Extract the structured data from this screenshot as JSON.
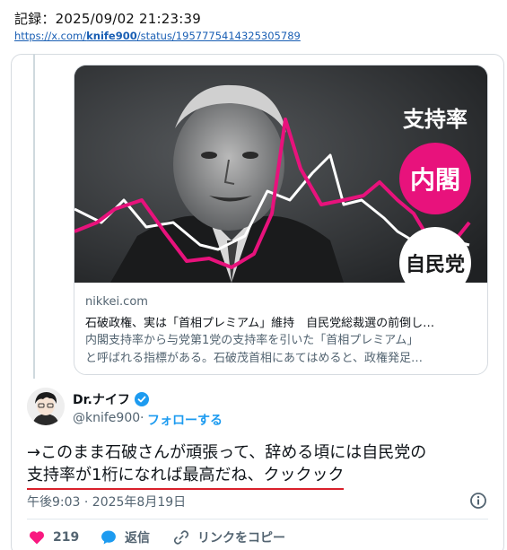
{
  "record": {
    "label": "記録：2025/09/02 21:23:39",
    "url_prefix": "https://x.com/",
    "url_user": "knife900",
    "url_suffix": "/status/1957775414325305789"
  },
  "link_card": {
    "image_text": {
      "heading": "支持率",
      "badge1": "内閣",
      "badge2": "自民党"
    },
    "domain": "nikkei.com",
    "title": "石破政権、実は「首相プレミアム」維持　自民党総裁選の前倒し…",
    "description_line1": "内閣支持率から与党第1党の支持率を引いた「首相プレミアム」",
    "description_line2": "と呼ばれる指標がある。石破茂首相にあてはめると、政権発足…",
    "colors": {
      "pink": "#e8127c",
      "dark": "#2b2d2f"
    }
  },
  "tweet": {
    "author_name": "Dr.ナイフ",
    "handle": "@knife900",
    "follow_label": "フォローする",
    "text_line1": "→このまま石破さんが頑張って、辞める頃には自民党の",
    "text_line2": "支持率が1桁になれば最高だね、クックック",
    "timestamp": "午後9:03 · 2025年8月19日",
    "like_count": "219",
    "reply_label": "返信",
    "copy_label": "リンクをコピー",
    "colors": {
      "accent": "#1d9bf0",
      "like": "#f91880",
      "underline": "#d9202b"
    }
  },
  "icons": {
    "verified": "verified-badge-icon",
    "info": "info-icon",
    "like": "heart-icon",
    "reply": "speech-bubble-icon",
    "copy": "link-icon"
  }
}
